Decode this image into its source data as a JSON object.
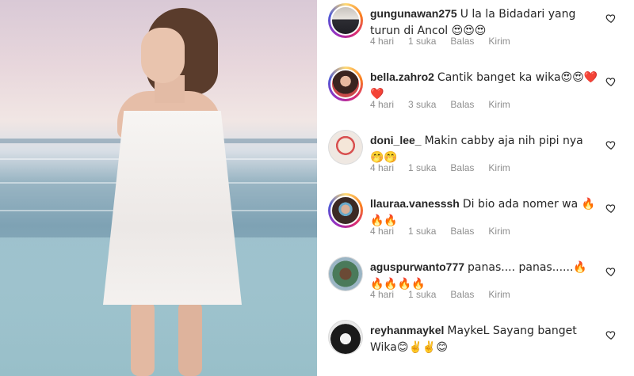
{
  "comments": [
    {
      "username": "gungunawan275",
      "text": "U la la  Bidadari yang turun di Ancol 😍😍😍",
      "time": "4 hari",
      "likes": "1 suka",
      "reply": "Balas",
      "send": "Kirim",
      "ring": "story"
    },
    {
      "username": "bella.zahro2",
      "text": "Cantik banget ka wika😍😍❤️❤️",
      "time": "4 hari",
      "likes": "3 suka",
      "reply": "Balas",
      "send": "Kirim",
      "ring": "story"
    },
    {
      "username": "doni_lee_",
      "text": "Makin cabby aja nih pipi nya 🤭🤭",
      "time": "4 hari",
      "likes": "1 suka",
      "reply": "Balas",
      "send": "Kirim",
      "ring": "plain"
    },
    {
      "username": "llauraa.vanesssh",
      "text": "Di bio ada nomer wa 🔥🔥🔥",
      "time": "4 hari",
      "likes": "1 suka",
      "reply": "Balas",
      "send": "Kirim",
      "ring": "story"
    },
    {
      "username": "aguspurwanto777",
      "text": "panas.... panas......🔥🔥🔥🔥🔥",
      "time": "4 hari",
      "likes": "1 suka",
      "reply": "Balas",
      "send": "Kirim",
      "ring": "plain"
    },
    {
      "username": "reyhanmaykel",
      "text": "MaykeL Sayang banget Wika😊✌️✌️😊",
      "time": "",
      "likes": "",
      "reply": "",
      "send": "",
      "ring": "plain"
    }
  ],
  "colors": {
    "meta": "#8e8e8e",
    "text": "#262626"
  }
}
